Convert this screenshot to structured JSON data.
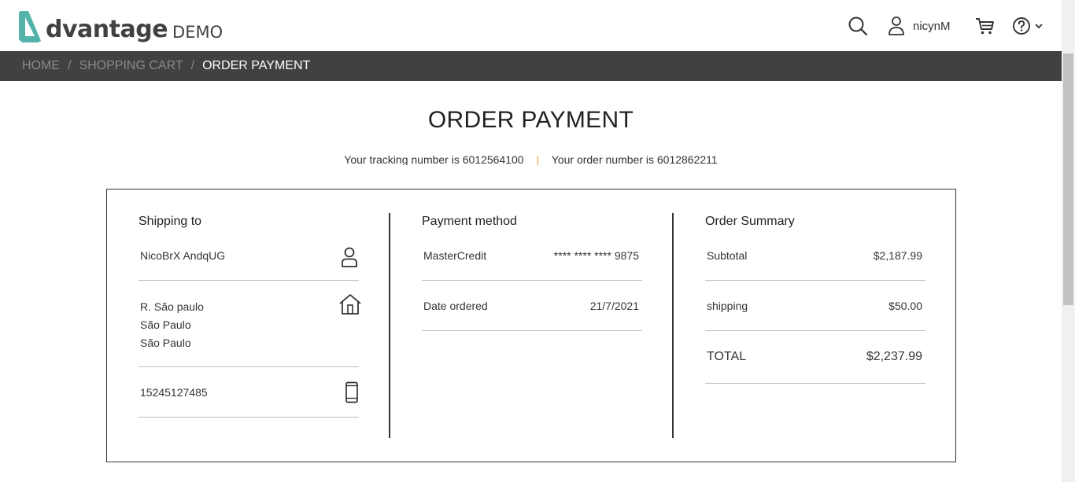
{
  "header": {
    "logo_word": "dvantage",
    "logo_demo": "DEMO",
    "user_name": "nicynM"
  },
  "breadcrumb": {
    "items": [
      "HOME",
      "SHOPPING CART",
      "ORDER PAYMENT"
    ],
    "separator": "/"
  },
  "page": {
    "title": "ORDER PAYMENT",
    "tracking_text": "Your tracking number is 6012564100",
    "order_text": "Your order number is 6012862211",
    "divider": "|"
  },
  "shipping": {
    "title": "Shipping to",
    "name": "NicoBrX AndqUG",
    "address_line1": "R. São paulo",
    "address_line2": "São Paulo",
    "address_line3": "São Paulo",
    "phone": "15245127485"
  },
  "payment": {
    "title": "Payment method",
    "method_label": "MasterCredit",
    "card_number": "**** **** **** 9875",
    "date_label": "Date ordered",
    "date_value": "21/7/2021"
  },
  "summary": {
    "title": "Order Summary",
    "subtotal_label": "Subtotal",
    "subtotal_value": "$2,187.99",
    "shipping_label": "shipping",
    "shipping_value": "$50.00",
    "total_label": "TOTAL",
    "total_value": "$2,237.99"
  },
  "colors": {
    "brand_teal": "#54b3a8",
    "crumb_bar": "#414141",
    "divider_accent": "#f0a030"
  },
  "icons": {
    "search": "search-icon",
    "user": "user-icon",
    "cart": "cart-icon",
    "help": "help-icon",
    "person": "person-icon",
    "home": "home-icon",
    "phone": "mobile-phone-icon"
  }
}
